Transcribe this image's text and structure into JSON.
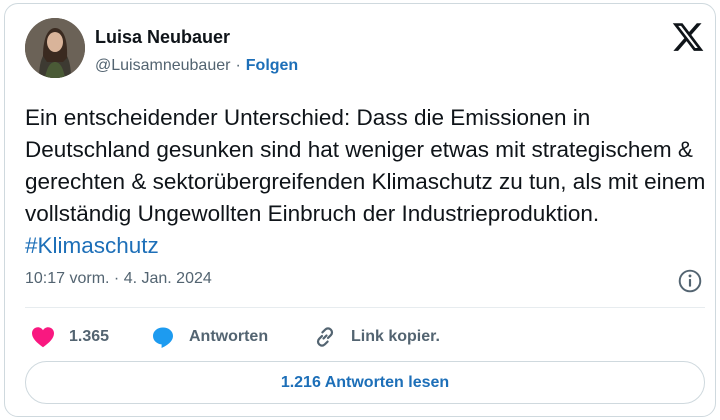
{
  "author": {
    "name": "Luisa Neubauer",
    "handle": "@Luisamneubauer",
    "separator": "·",
    "follow_label": "Folgen"
  },
  "tweet": {
    "text": "Ein entscheidender Unterschied: Dass die Emissionen in Deutschland gesunken sind hat weniger etwas mit strategischem & gerechten & sektorübergreifenden Klimaschutz zu tun, als mit einem vollständig Ungewollten Einbruch der Industrieproduktion. ",
    "hashtag": "#Klimaschutz",
    "timestamp": "10:17 vorm. · 4. Jan. 2024"
  },
  "actions": {
    "like_count": "1.365",
    "reply_label": "Antworten",
    "copy_link_label": "Link kopier."
  },
  "read_replies_label": "1.216 Antworten lesen",
  "icons": {
    "platform": "x-logo-icon",
    "info": "info-icon",
    "like": "heart-icon",
    "reply": "speech-bubble-icon",
    "copy": "link-icon"
  },
  "colors": {
    "link": "#1d6fb8",
    "heart": "#f91880",
    "reply": "#1d9bf0",
    "muted": "#536471",
    "text": "#0f1419",
    "border": "#cfd9de"
  }
}
